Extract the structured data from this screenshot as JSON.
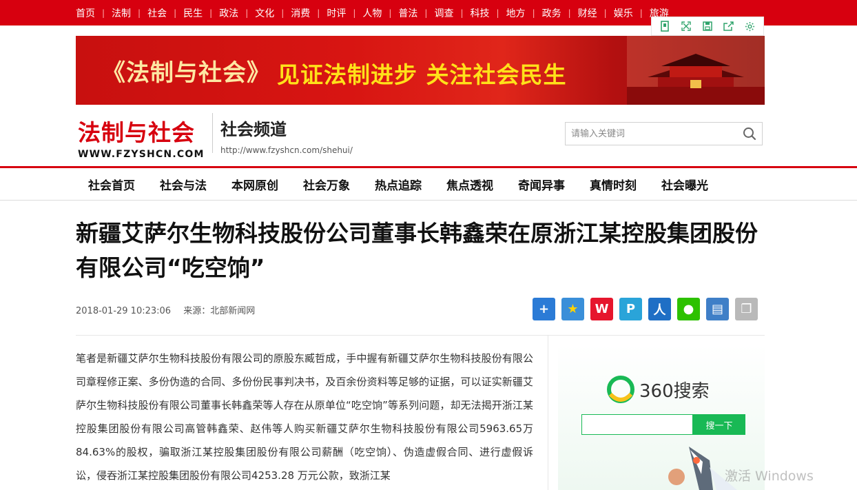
{
  "topnav": [
    "首页",
    "法制",
    "社会",
    "民生",
    "政法",
    "文化",
    "消费",
    "时评",
    "人物",
    "普法",
    "调查",
    "科技",
    "地方",
    "政务",
    "财经",
    "娱乐",
    "旅游"
  ],
  "floatbar": [
    "bookmark-icon",
    "fullscreen-icon",
    "save-icon",
    "share-out-icon",
    "gear-icon"
  ],
  "banner": {
    "magazine": "《法制与社会》",
    "slogan": "见证法制进步 关注社会民生"
  },
  "logo": {
    "name": "法制与社会",
    "url": "WWW.FZYSHCN.COM"
  },
  "channel": {
    "name": "社会频道",
    "url": "http://www.fzyshcn.com/shehui/"
  },
  "search": {
    "placeholder": "请输入关键词"
  },
  "channel_nav": [
    "社会首页",
    "社会与法",
    "本网原创",
    "社会万象",
    "热点追踪",
    "焦点透视",
    "奇闻异事",
    "真情时刻",
    "社会曝光"
  ],
  "article": {
    "title": "新疆艾萨尔生物科技股份公司董事长韩鑫荣在原浙江某控股集团股份有限公司“吃空饷”",
    "date": "2018-01-29 10:23:06",
    "source": "来源：北部新闻网",
    "body": "笔者是新疆艾萨尔生物科技股份有限公司的原股东臧哲成，手中握有新疆艾萨尔生物科技股份有限公司章程修正案、多份伪造的合同、多份份民事判决书，及百余份资料等足够的证据，可以证实新疆艾萨尔生物科技股份有限公司董事长韩鑫荣等人存在从原单位“吃空饷”等系列问题，却无法揭开浙江某控股集团股份有限公司高管韩鑫荣、赵伟等人购买新疆艾萨尔生物科技股份有限公司5963.65万84.63%的股权，骗取浙江某控股集团股份有限公司薪酬（吃空饷）、伪造虚假合同、进行虚假诉讼，侵吞浙江某控股集团股份有限公司4253.28 万元公款，致浙江某"
  },
  "share": [
    {
      "icon": "plus-icon",
      "color": "#2b7bd6"
    },
    {
      "icon": "star-icon",
      "color": "#3a8fd9"
    },
    {
      "icon": "weibo-icon",
      "color": "#e6162d"
    },
    {
      "icon": "qzone-icon",
      "color": "#2aa4d9"
    },
    {
      "icon": "renren-icon",
      "color": "#1f6fc5"
    },
    {
      "icon": "wechat-icon",
      "color": "#2dc100"
    },
    {
      "icon": "print-icon",
      "color": "#3f7fc7"
    },
    {
      "icon": "copy-icon",
      "color": "#b9b9b9"
    }
  ],
  "sidebar": {
    "brand": "360搜索",
    "button": "搜一下"
  },
  "watermark": "激活 Windows"
}
